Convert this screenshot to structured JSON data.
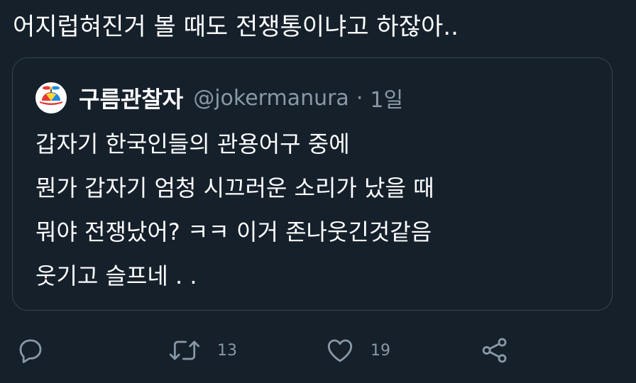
{
  "tweet": {
    "text": "어지럽혀진거 볼 때도 전쟁통이냐고 하잖아.."
  },
  "quote": {
    "display_name": "구름관찰자",
    "handle": "@jokermanura",
    "separator": "·",
    "time": "1일",
    "avatar_icon": "propeller-cap-icon",
    "lines": [
      "갑자기 한국인들의 관용어구 중에",
      "뭔가 갑자기 엄청 시끄러운 소리가 났을 때",
      "뭐야 전쟁났어? ㅋㅋ 이거 존나웃긴것같음",
      "웃기고 슬프네 . ."
    ]
  },
  "actions": {
    "reply": {
      "icon": "reply-icon"
    },
    "retweet": {
      "icon": "retweet-icon",
      "count": "13"
    },
    "like": {
      "icon": "heart-icon",
      "count": "19"
    },
    "share": {
      "icon": "share-icon"
    }
  },
  "colors": {
    "background": "#15202b",
    "border": "#38444d",
    "secondary_text": "#8899a6",
    "primary_text": "#ffffff"
  }
}
